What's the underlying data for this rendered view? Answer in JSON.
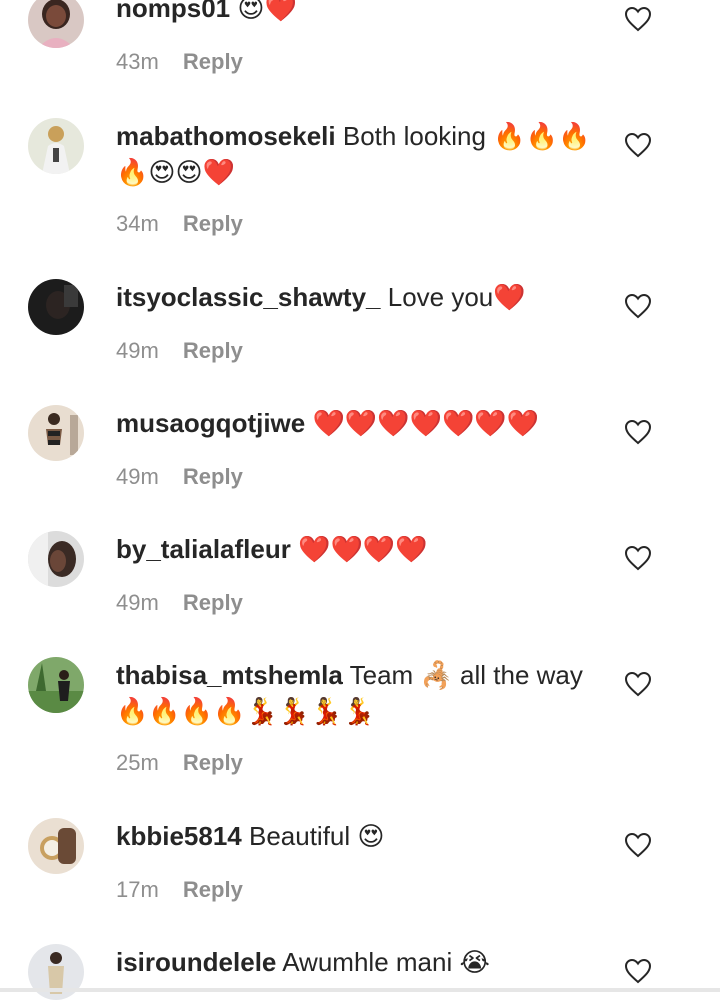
{
  "comments": [
    {
      "username": "nomps01",
      "text": "😍❤️",
      "time": "43m",
      "reply_label": "Reply"
    },
    {
      "username": "mabathomosekeli",
      "text": "Both looking 🔥🔥🔥🔥😍😍❤️",
      "time": "34m",
      "reply_label": "Reply"
    },
    {
      "username": "itsyoclassic_shawty_",
      "text": "Love you❤️",
      "time": "49m",
      "reply_label": "Reply"
    },
    {
      "username": "musaogqotjiwe",
      "text": "❤️❤️❤️❤️❤️❤️❤️",
      "time": "49m",
      "reply_label": "Reply"
    },
    {
      "username": "by_talialafleur",
      "text": "❤️❤️❤️❤️",
      "time": "49m",
      "reply_label": "Reply"
    },
    {
      "username": "thabisa_mtshemla",
      "text": "Team 🦂 all the way 🔥🔥🔥🔥💃💃💃💃",
      "time": "25m",
      "reply_label": "Reply"
    },
    {
      "username": "kbbie5814",
      "text": "Beautiful 😍",
      "time": "17m",
      "reply_label": "Reply"
    },
    {
      "username": "isiroundelele",
      "text": "Awumhle mani 😭",
      "time": "",
      "reply_label": ""
    }
  ],
  "icons": {
    "like": "heart-outline-icon"
  },
  "colors": {
    "text": "#262626",
    "secondary": "#8e8e8e",
    "background": "#ffffff"
  }
}
